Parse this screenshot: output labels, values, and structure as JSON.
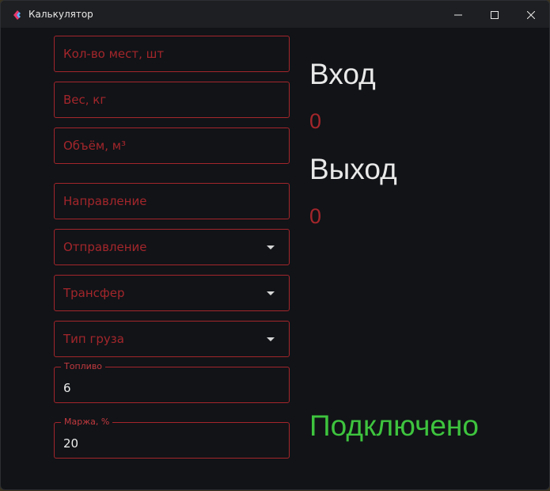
{
  "window": {
    "title": "Калькулятор",
    "icons": {
      "app": "flutter-logo-icon",
      "minimize": "minimize-icon",
      "maximize": "maximize-icon",
      "close": "close-icon"
    }
  },
  "form": {
    "places_placeholder": "Кол-во мест, шт",
    "weight_placeholder": "Вес, кг",
    "volume_placeholder": "Объём, м³",
    "direction_placeholder": "Направление",
    "departure_placeholder": "Отправление",
    "transfer_placeholder": "Трансфер",
    "cargo_type_placeholder": "Тип груза",
    "fuel_label": "Топливо",
    "fuel_value": "6",
    "margin_label": "Маржа, %",
    "margin_value": "20"
  },
  "results": {
    "input_heading": "Вход",
    "input_value": "0",
    "output_heading": "Выход",
    "output_value": "0"
  },
  "status": {
    "text": "Подключено"
  },
  "colors": {
    "accent_red": "#a3262b",
    "status_green": "#3ec43e",
    "background": "#111317",
    "titlebar": "#1e1f22"
  }
}
